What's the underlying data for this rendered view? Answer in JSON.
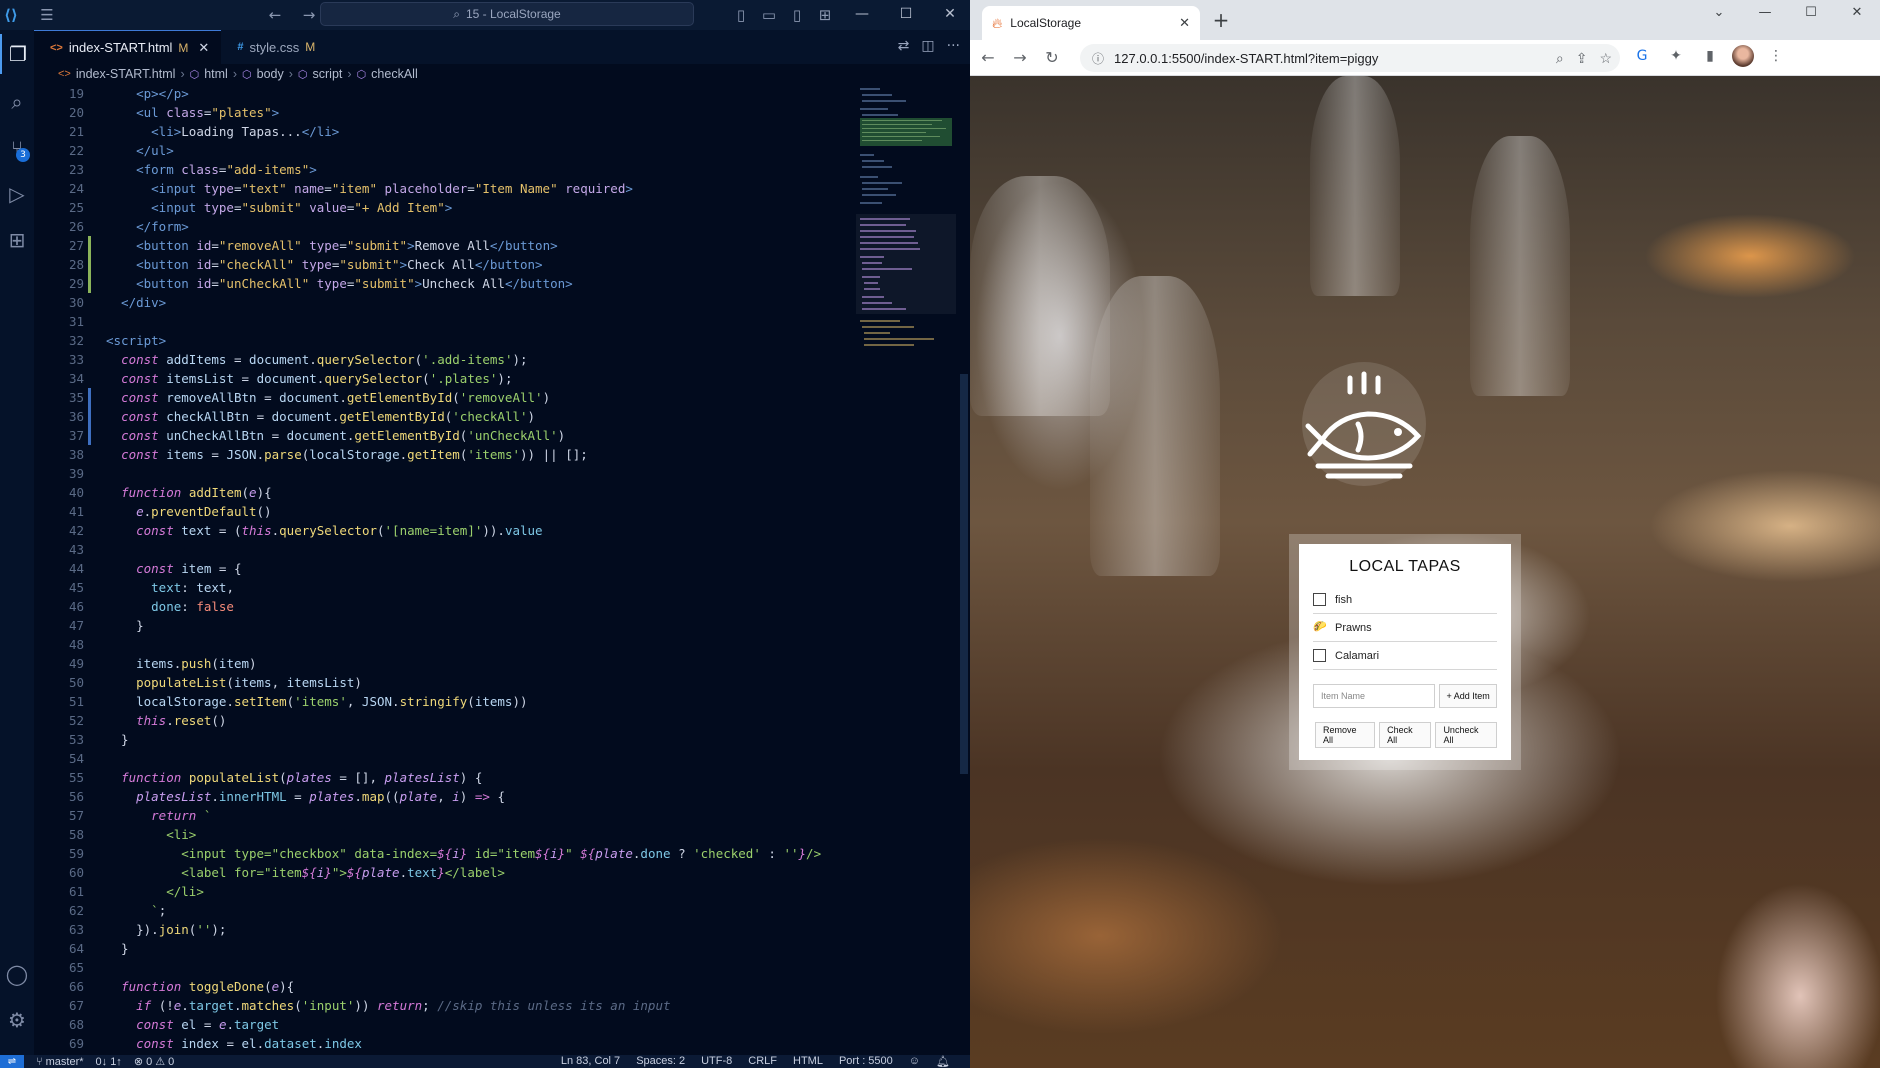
{
  "vscode": {
    "search_text": "15 - LocalStorage",
    "tabs": [
      {
        "label": "index-START.html",
        "modified": "M",
        "icon": "<>"
      },
      {
        "label": "style.css",
        "modified": "M",
        "icon": "#"
      }
    ],
    "breadcrumb": [
      "index-START.html",
      "html",
      "body",
      "script",
      "checkAll"
    ],
    "scm_badge": "3",
    "code_lines": [
      {
        "n": "19",
        "html": "<span class='t-tag'>    &lt;p&gt;&lt;/p&gt;</span>"
      },
      {
        "n": "20",
        "html": "<span class='t-tag'>    &lt;ul </span><span class='t-attr'>class</span><span class='t-punc'>=</span><span class='t-val'>\"plates\"</span><span class='t-tag'>&gt;</span>"
      },
      {
        "n": "21",
        "html": "<span class='t-tag'>      &lt;li&gt;</span><span class='t-def'>Loading Tapas...</span><span class='t-tag'>&lt;/li&gt;</span>"
      },
      {
        "n": "22",
        "html": "<span class='t-tag'>    &lt;/ul&gt;</span>"
      },
      {
        "n": "23",
        "html": "<span class='t-tag'>    &lt;form </span><span class='t-attr'>class</span><span class='t-punc'>=</span><span class='t-val'>\"add-items\"</span><span class='t-tag'>&gt;</span>"
      },
      {
        "n": "24",
        "html": "<span class='t-tag'>      &lt;input </span><span class='t-attr'>type</span><span class='t-punc'>=</span><span class='t-val'>\"text\"</span> <span class='t-attr'>name</span><span class='t-punc'>=</span><span class='t-val'>\"item\"</span> <span class='t-attr'>placeholder</span><span class='t-punc'>=</span><span class='t-val'>\"Item Name\"</span> <span class='t-attr'>required</span><span class='t-tag'>&gt;</span>"
      },
      {
        "n": "25",
        "html": "<span class='t-tag'>      &lt;input </span><span class='t-attr'>type</span><span class='t-punc'>=</span><span class='t-val'>\"submit\"</span> <span class='t-attr'>value</span><span class='t-punc'>=</span><span class='t-val'>\"+ Add Item\"</span><span class='t-tag'>&gt;</span>"
      },
      {
        "n": "26",
        "html": "<span class='t-tag'>    &lt;/form&gt;</span>"
      },
      {
        "n": "27",
        "gutter": "mod",
        "html": "<span class='t-tag'>    &lt;button </span><span class='t-attr'>id</span><span class='t-punc'>=</span><span class='t-val'>\"removeAll\"</span> <span class='t-attr'>type</span><span class='t-punc'>=</span><span class='t-val'>\"submit\"</span><span class='t-tag'>&gt;</span><span class='t-def'>Remove All</span><span class='t-tag'>&lt;/button&gt;</span>"
      },
      {
        "n": "28",
        "gutter": "mod",
        "html": "<span class='t-tag'>    &lt;button </span><span class='t-attr'>id</span><span class='t-punc'>=</span><span class='t-val'>\"checkAll\"</span> <span class='t-attr'>type</span><span class='t-punc'>=</span><span class='t-val'>\"submit\"</span><span class='t-tag'>&gt;</span><span class='t-def'>Check All</span><span class='t-tag'>&lt;/button&gt;</span>"
      },
      {
        "n": "29",
        "gutter": "mod",
        "html": "<span class='t-tag'>    &lt;button </span><span class='t-attr'>id</span><span class='t-punc'>=</span><span class='t-val'>\"unCheckAll\"</span> <span class='t-attr'>type</span><span class='t-punc'>=</span><span class='t-val'>\"submit\"</span><span class='t-tag'>&gt;</span><span class='t-def'>Uncheck All</span><span class='t-tag'>&lt;/button&gt;</span>"
      },
      {
        "n": "30",
        "html": "<span class='t-tag'>  &lt;/div&gt;</span>"
      },
      {
        "n": "31",
        "html": ""
      },
      {
        "n": "32",
        "html": "<span class='t-tag'>&lt;script&gt;</span>"
      },
      {
        "n": "33",
        "html": "  <span class='t-kw'>const</span> <span class='t-var'>addItems</span> <span class='t-punc'>=</span> <span class='t-var'>document</span>.<span class='t-fn'>querySelector</span>(<span class='t-str'>'.add-items'</span>);"
      },
      {
        "n": "34",
        "html": "  <span class='t-kw'>const</span> <span class='t-var'>itemsList</span> <span class='t-punc'>=</span> <span class='t-var'>document</span>.<span class='t-fn'>querySelector</span>(<span class='t-str'>'.plates'</span>);"
      },
      {
        "n": "35",
        "gutter": "add",
        "html": "  <span class='t-kw'>const</span> <span class='t-var'>removeAllBtn</span> <span class='t-punc'>=</span> <span class='t-var'>document</span>.<span class='t-fn'>getElementById</span>(<span class='t-str'>'removeAll'</span>)"
      },
      {
        "n": "36",
        "gutter": "add",
        "html": "  <span class='t-kw'>const</span> <span class='t-var'>checkAllBtn</span> <span class='t-punc'>=</span> <span class='t-var'>document</span>.<span class='t-fn'>getElementById</span>(<span class='t-str'>'checkAll'</span>)"
      },
      {
        "n": "37",
        "gutter": "add",
        "html": "  <span class='t-kw'>const</span> <span class='t-var'>unCheckAllBtn</span> <span class='t-punc'>=</span> <span class='t-var'>document</span>.<span class='t-fn'>getElementById</span>(<span class='t-str'>'unCheckAll'</span>)"
      },
      {
        "n": "38",
        "html": "  <span class='t-kw'>const</span> <span class='t-var'>items</span> <span class='t-punc'>=</span> <span class='t-var'>JSON</span>.<span class='t-fn'>parse</span>(<span class='t-var'>localStorage</span>.<span class='t-fn'>getItem</span>(<span class='t-str'>'items'</span>)) <span class='t-punc'>||</span> [];"
      },
      {
        "n": "39",
        "html": ""
      },
      {
        "n": "40",
        "html": "  <span class='t-kw'>function</span> <span class='t-fn'>addItem</span>(<span class='t-param'>e</span>){"
      },
      {
        "n": "41",
        "html": "    <span class='t-param'>e</span>.<span class='t-fn'>preventDefault</span>()"
      },
      {
        "n": "42",
        "html": "    <span class='t-kw'>const</span> <span class='t-var'>text</span> <span class='t-punc'>=</span> (<span class='t-kw'>this</span>.<span class='t-fn'>querySelector</span>(<span class='t-str'>'[name=item]'</span>)).<span class='t-prop'>value</span>"
      },
      {
        "n": "43",
        "html": ""
      },
      {
        "n": "44",
        "html": "    <span class='t-kw'>const</span> <span class='t-var'>item</span> <span class='t-punc'>=</span> {"
      },
      {
        "n": "45",
        "html": "      <span class='t-prop'>text</span>: <span class='t-var'>text</span>,"
      },
      {
        "n": "46",
        "html": "      <span class='t-prop'>done</span>: <span class='t-bool'>false</span>"
      },
      {
        "n": "47",
        "html": "    }"
      },
      {
        "n": "48",
        "html": ""
      },
      {
        "n": "49",
        "html": "    <span class='t-var'>items</span>.<span class='t-fn'>push</span>(<span class='t-var'>item</span>)"
      },
      {
        "n": "50",
        "html": "    <span class='t-fn'>populateList</span>(<span class='t-var'>items</span>, <span class='t-var'>itemsList</span>)"
      },
      {
        "n": "51",
        "html": "    <span class='t-var'>localStorage</span>.<span class='t-fn'>setItem</span>(<span class='t-str'>'items'</span>, <span class='t-var'>JSON</span>.<span class='t-fn'>stringify</span>(<span class='t-var'>items</span>))"
      },
      {
        "n": "52",
        "html": "    <span class='t-kw'>this</span>.<span class='t-fn'>reset</span>()"
      },
      {
        "n": "53",
        "html": "  }"
      },
      {
        "n": "54",
        "html": ""
      },
      {
        "n": "55",
        "html": "  <span class='t-kw'>function</span> <span class='t-fn'>populateList</span>(<span class='t-param'>plates</span> <span class='t-punc'>=</span> [], <span class='t-param'>platesList</span>) {"
      },
      {
        "n": "56",
        "html": "    <span class='t-param'>platesList</span>.<span class='t-prop'>innerHTML</span> <span class='t-punc'>=</span> <span class='t-param'>plates</span>.<span class='t-fn'>map</span>((<span class='t-param'>plate</span>, <span class='t-param'>i</span>) <span class='t-kw'>=&gt;</span> {"
      },
      {
        "n": "57",
        "html": "      <span class='t-kw'>return</span> <span class='t-str'>`</span>"
      },
      {
        "n": "58",
        "html": "        <span class='t-str'>&lt;li&gt;</span>"
      },
      {
        "n": "59",
        "html": "          <span class='t-str'>&lt;input type=\"checkbox\" data-index=</span><span class='t-kw'>${</span><span class='t-param'>i</span><span class='t-kw'>}</span><span class='t-str'> id=\"item</span><span class='t-kw'>${</span><span class='t-param'>i</span><span class='t-kw'>}</span><span class='t-str'>\" </span><span class='t-kw'>${</span><span class='t-param'>plate</span>.<span class='t-prop'>done</span> <span class='t-punc'>?</span> <span class='t-str'>'checked'</span> <span class='t-punc'>:</span> <span class='t-str'>''</span><span class='t-kw'>}</span><span class='t-str'>/&gt;</span>"
      },
      {
        "n": "60",
        "html": "          <span class='t-str'>&lt;label for=\"item</span><span class='t-kw'>${</span><span class='t-param'>i</span><span class='t-kw'>}</span><span class='t-str'>\"&gt;</span><span class='t-kw'>${</span><span class='t-param'>plate</span>.<span class='t-prop'>text</span><span class='t-kw'>}</span><span class='t-str'>&lt;/label&gt;</span>"
      },
      {
        "n": "61",
        "html": "        <span class='t-str'>&lt;/li&gt;</span>"
      },
      {
        "n": "62",
        "html": "      <span class='t-str'>`</span>;"
      },
      {
        "n": "63",
        "html": "    }).<span class='t-fn'>join</span>(<span class='t-str'>''</span>);"
      },
      {
        "n": "64",
        "html": "  }"
      },
      {
        "n": "65",
        "html": ""
      },
      {
        "n": "66",
        "html": "  <span class='t-kw'>function</span> <span class='t-fn'>toggleDone</span>(<span class='t-param'>e</span>){"
      },
      {
        "n": "67",
        "html": "    <span class='t-kw'>if</span> (<span class='t-punc'>!</span><span class='t-param'>e</span>.<span class='t-prop'>target</span>.<span class='t-fn'>matches</span>(<span class='t-str'>'input'</span>)) <span class='t-kw'>return</span>; <span class='t-cmt'>//skip this unless its an input</span>"
      },
      {
        "n": "68",
        "html": "    <span class='t-kw'>const</span> <span class='t-var'>el</span> <span class='t-punc'>=</span> <span class='t-param'>e</span>.<span class='t-prop'>target</span>"
      },
      {
        "n": "69",
        "html": "    <span class='t-kw'>const</span> <span class='t-var'>index</span> <span class='t-punc'>=</span> <span class='t-var'>el</span>.<span class='t-prop'>dataset</span>.<span class='t-prop'>index</span>"
      }
    ],
    "status": {
      "branch": "master*",
      "sync": "0↓ 1↑",
      "problems": "⊗ 0 ⚠ 0",
      "position": "Ln 83, Col 7",
      "spaces": "Spaces: 2",
      "encoding": "UTF-8",
      "eol": "CRLF",
      "language": "HTML",
      "port": "Port : 5500"
    }
  },
  "browser": {
    "tab_title": "LocalStorage",
    "url": "127.0.0.1:5500/index-START.html?item=piggy"
  },
  "app": {
    "title": "LOCAL TAPAS",
    "items": [
      {
        "label": "fish",
        "checked": false
      },
      {
        "label": "Prawns",
        "checked": true
      },
      {
        "label": "Calamari",
        "checked": false
      }
    ],
    "input_placeholder": "Item Name",
    "add_label": "+ Add Item",
    "remove_all": "Remove All",
    "check_all": "Check All",
    "uncheck_all": "Uncheck All"
  },
  "colors": {
    "vscode_bg": "#020b1e",
    "status_remote": "#1e6ed6",
    "browser_tabstrip": "#dfe3e8"
  }
}
